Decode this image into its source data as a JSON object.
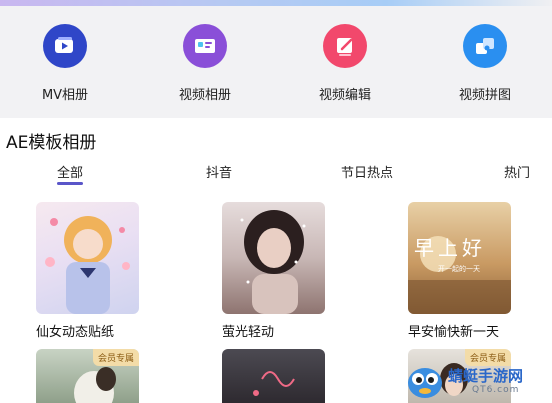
{
  "features": [
    {
      "label": "MV相册",
      "icon": "mv-album-icon",
      "color": "#2f46c8"
    },
    {
      "label": "视频相册",
      "icon": "video-album-icon",
      "color": "#8a4fd8"
    },
    {
      "label": "视频编辑",
      "icon": "video-edit-icon",
      "color": "#f2486c"
    },
    {
      "label": "视频拼图",
      "icon": "video-puzzle-icon",
      "color": "#2a8ff0"
    }
  ],
  "section": {
    "title": "AE模板相册"
  },
  "tabs": [
    "全部",
    "抖音",
    "节日热点",
    "热门"
  ],
  "active_tab": "全部",
  "templates": [
    {
      "title": "仙女动态贴纸",
      "vip": ""
    },
    {
      "title": "萤光轻动",
      "vip": ""
    },
    {
      "title": "早安愉快新一天",
      "vip": "",
      "overlay_text": "早上好",
      "overlay_sub": "开一起的一天"
    },
    {
      "title": "",
      "vip": "会员专属"
    },
    {
      "title": "",
      "vip": ""
    },
    {
      "title": "",
      "vip": "会员专属"
    }
  ],
  "watermark": {
    "text": "蜻蜓手游网",
    "url": "QT6.com"
  },
  "colors": {
    "accent": "#5a56c9",
    "vip_bg": "#f3dca8"
  }
}
